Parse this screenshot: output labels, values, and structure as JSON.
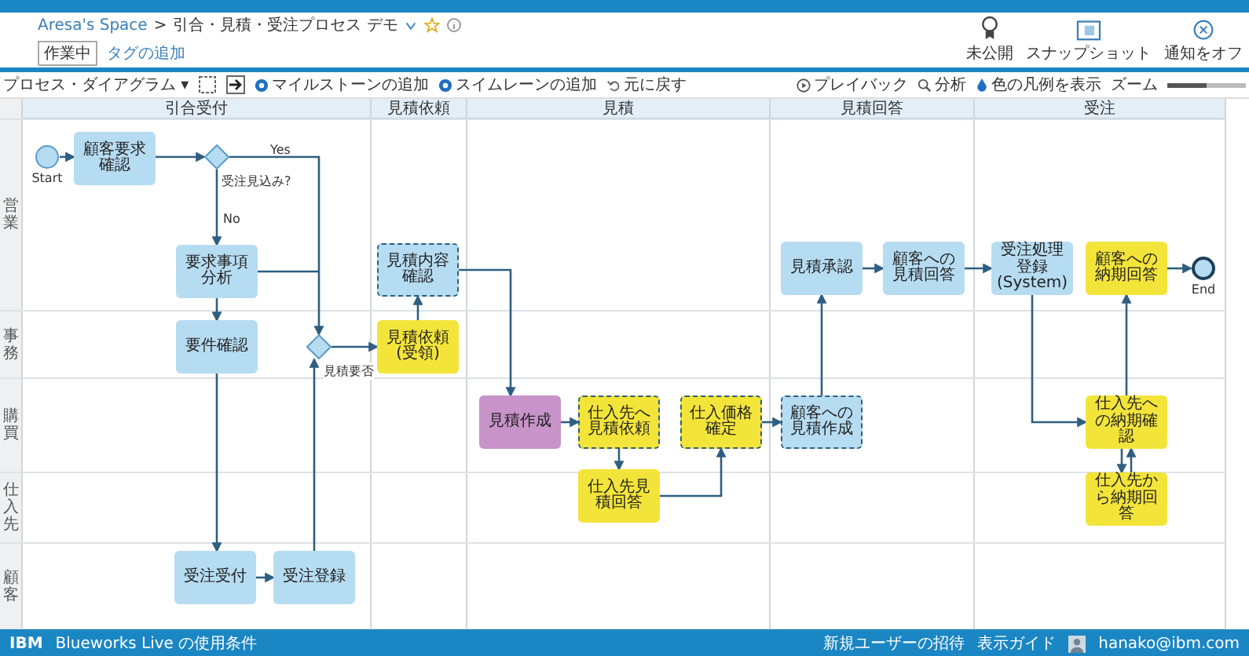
{
  "header": {
    "breadcrumb_space": "Aresa's Space",
    "breadcrumb_sep": ">",
    "title": "引合・見積・受注プロセス デモ",
    "status": "作業中",
    "tag_link": "タグの追加",
    "actions": [
      {
        "kind": "award",
        "label": "未公開"
      },
      {
        "kind": "snapshot",
        "label": "スナップショット"
      },
      {
        "kind": "close",
        "label": "通知をオフ"
      }
    ]
  },
  "toolbar": {
    "view": "プロセス・ダイアグラム",
    "view_caret": "▾",
    "add_milestone": "マイルストーンの追加",
    "add_lane": "スイムレーンの追加",
    "undo": "元に戻す",
    "playback": "プレイバック",
    "analyze": "分析",
    "legend": "色の凡例を表示",
    "zoom": "ズーム",
    "zoom_slider": {
      "level": 0.5
    }
  },
  "milestones": [
    {
      "label": "引合受付"
    },
    {
      "label": "見積依頼"
    },
    {
      "label": "見積"
    },
    {
      "label": "見積回答"
    },
    {
      "label": "受注"
    }
  ],
  "lanes": [
    {
      "label": "営業"
    },
    {
      "label": "事務"
    },
    {
      "label": "購買"
    },
    {
      "label": "仕入先"
    },
    {
      "label": "顧客"
    }
  ],
  "nodes": [
    {
      "kind": "start",
      "label": "Start"
    },
    {
      "kind": "task",
      "label": "顧客要求確認",
      "color": "#b6dcf2",
      "dashed": false
    },
    {
      "kind": "gateway",
      "label": "受注見込み?"
    },
    {
      "kind": "task",
      "label": "要求事項分析",
      "color": "#b6dcf2",
      "dashed": false
    },
    {
      "kind": "task",
      "label": "要件確認",
      "color": "#b6dcf2",
      "dashed": false
    },
    {
      "kind": "gateway",
      "label": "見積要否"
    },
    {
      "kind": "task",
      "label": "見積内容確認",
      "color": "#b6dcf2",
      "dashed": true
    },
    {
      "kind": "task",
      "label": "見積依頼(受領)",
      "color": "#f3e43a",
      "dashed": false
    },
    {
      "kind": "task",
      "label": "見積作成",
      "color": "#c793c8",
      "dashed": false
    },
    {
      "kind": "task",
      "label": "仕入先へ見積依頼",
      "color": "#f3e43a",
      "dashed": true
    },
    {
      "kind": "task",
      "label": "仕入先見積回答",
      "color": "#f3e43a",
      "dashed": false
    },
    {
      "kind": "task",
      "label": "仕入価格確定",
      "color": "#f3e43a",
      "dashed": true
    },
    {
      "kind": "task",
      "label": "見積承認",
      "color": "#b6dcf2",
      "dashed": false
    },
    {
      "kind": "task",
      "label": "顧客への見積作成",
      "color": "#b6dcf2",
      "dashed": true
    },
    {
      "kind": "task",
      "label": "顧客への見積回答",
      "color": "#b6dcf2",
      "dashed": false
    },
    {
      "kind": "task",
      "label": "受注処理登録 (System)",
      "color": "#b6dcf2",
      "dashed": false
    },
    {
      "kind": "task",
      "label": "顧客への納期回答",
      "color": "#f3e43a",
      "dashed": false
    },
    {
      "kind": "end",
      "label": "End"
    },
    {
      "kind": "task",
      "label": "仕入先への納期確認",
      "color": "#f3e43a",
      "dashed": false
    },
    {
      "kind": "task",
      "label": "仕入先から納期回答",
      "color": "#f3e43a",
      "dashed": false
    },
    {
      "kind": "task",
      "label": "受注受付",
      "color": "#b6dcf2",
      "dashed": false
    },
    {
      "kind": "task",
      "label": "受注登録",
      "color": "#b6dcf2",
      "dashed": false
    }
  ],
  "branch_labels": [
    {
      "text": "Yes"
    },
    {
      "text": "No"
    }
  ],
  "footer": {
    "brand": "IBM",
    "terms": "Blueworks Live の使用条件",
    "invite": "新規ユーザーの招待",
    "guide": "表示ガイド",
    "user": "hanako@ibm.com"
  }
}
